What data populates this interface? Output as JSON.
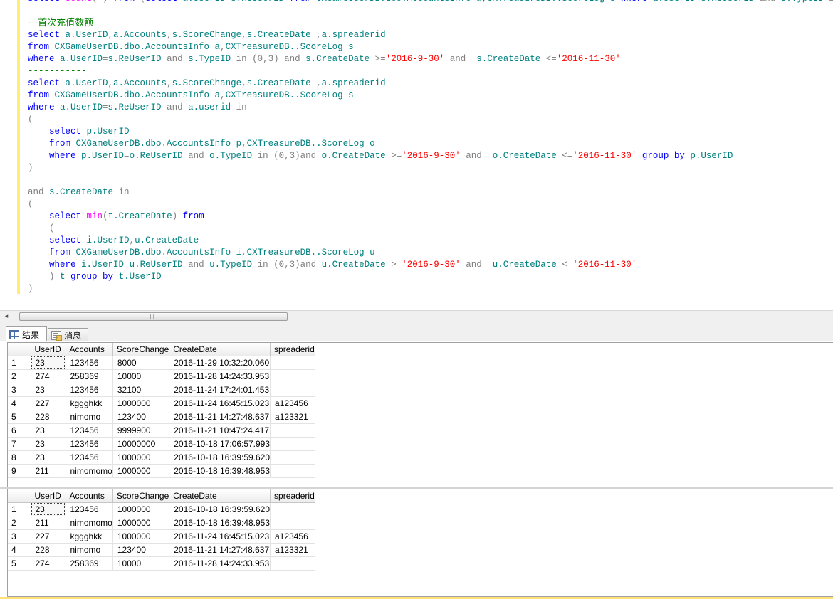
{
  "editor": {
    "lines": [
      [
        {
          "t": "select ",
          "c": "kw"
        },
        {
          "t": "count",
          "c": "fn"
        },
        {
          "t": "(*) ",
          "c": "gy"
        },
        {
          "t": "from ",
          "c": "kw"
        },
        {
          "t": "(",
          "c": "gy"
        },
        {
          "t": "select ",
          "c": "kw"
        },
        {
          "t": "a.UserID s.ReUserID ",
          "c": "tl"
        },
        {
          "t": "from ",
          "c": "kw"
        },
        {
          "t": "CXGameUserDB.dbo.AccountsInfo a,CXTreasureDB..ScoreLog s ",
          "c": "tl"
        },
        {
          "t": "where ",
          "c": "kw"
        },
        {
          "t": "a.UserID=s.ReUserID ",
          "c": "tl"
        },
        {
          "t": "and ",
          "c": "gy"
        },
        {
          "t": "s.TypeID ",
          "c": "tl"
        },
        {
          "t": "in",
          "c": "gy"
        }
      ],
      [],
      [
        {
          "t": "---首次充值数额",
          "c": "cm cm-cjk"
        }
      ],
      [
        {
          "t": "select ",
          "c": "kw"
        },
        {
          "t": "a.UserID",
          "c": "tl"
        },
        {
          "t": ",",
          "c": "gy"
        },
        {
          "t": "a.Accounts",
          "c": "tl"
        },
        {
          "t": ",",
          "c": "gy"
        },
        {
          "t": "s.ScoreChange",
          "c": "tl"
        },
        {
          "t": ",",
          "c": "gy"
        },
        {
          "t": "s.CreateDate ",
          "c": "tl"
        },
        {
          "t": ",",
          "c": "gy"
        },
        {
          "t": "a.spreaderid",
          "c": "tl"
        }
      ],
      [
        {
          "t": "from ",
          "c": "kw"
        },
        {
          "t": "CXGameUserDB.dbo.AccountsInfo a",
          "c": "tl"
        },
        {
          "t": ",",
          "c": "gy"
        },
        {
          "t": "CXTreasureDB..ScoreLog s",
          "c": "tl"
        }
      ],
      [
        {
          "t": "where ",
          "c": "kw"
        },
        {
          "t": "a.UserID",
          "c": "tl"
        },
        {
          "t": "=",
          "c": "gy"
        },
        {
          "t": "s.ReUserID ",
          "c": "tl"
        },
        {
          "t": "and ",
          "c": "gy"
        },
        {
          "t": "s.TypeID ",
          "c": "tl"
        },
        {
          "t": "in ",
          "c": "gy"
        },
        {
          "t": "(0,3) ",
          "c": "gy"
        },
        {
          "t": "and ",
          "c": "gy"
        },
        {
          "t": "s.CreateDate ",
          "c": "tl"
        },
        {
          "t": ">=",
          "c": "gy"
        },
        {
          "t": "'2016-9-30' ",
          "c": "str"
        },
        {
          "t": "and  ",
          "c": "gy"
        },
        {
          "t": "s.CreateDate ",
          "c": "tl"
        },
        {
          "t": "<=",
          "c": "gy"
        },
        {
          "t": "'2016-11-30'",
          "c": "str"
        }
      ],
      [
        {
          "t": "-----------",
          "c": "cm"
        }
      ],
      [
        {
          "t": "select ",
          "c": "kw"
        },
        {
          "t": "a.UserID",
          "c": "tl"
        },
        {
          "t": ",",
          "c": "gy"
        },
        {
          "t": "a.Accounts",
          "c": "tl"
        },
        {
          "t": ",",
          "c": "gy"
        },
        {
          "t": "s.ScoreChange",
          "c": "tl"
        },
        {
          "t": ",",
          "c": "gy"
        },
        {
          "t": "s.CreateDate ",
          "c": "tl"
        },
        {
          "t": ",",
          "c": "gy"
        },
        {
          "t": "a.spreaderid",
          "c": "tl"
        }
      ],
      [
        {
          "t": "from ",
          "c": "kw"
        },
        {
          "t": "CXGameUserDB.dbo.AccountsInfo a",
          "c": "tl"
        },
        {
          "t": ",",
          "c": "gy"
        },
        {
          "t": "CXTreasureDB..ScoreLog s",
          "c": "tl"
        }
      ],
      [
        {
          "t": "where ",
          "c": "kw"
        },
        {
          "t": "a.UserID",
          "c": "tl"
        },
        {
          "t": "=",
          "c": "gy"
        },
        {
          "t": "s.ReUserID ",
          "c": "tl"
        },
        {
          "t": "and ",
          "c": "gy"
        },
        {
          "t": "a.userid ",
          "c": "tl"
        },
        {
          "t": "in",
          "c": "gy"
        }
      ],
      [
        {
          "t": "(",
          "c": "gy"
        }
      ],
      [
        {
          "t": "    "
        },
        {
          "t": "select ",
          "c": "kw"
        },
        {
          "t": "p.UserID",
          "c": "tl"
        }
      ],
      [
        {
          "t": "    "
        },
        {
          "t": "from ",
          "c": "kw"
        },
        {
          "t": "CXGameUserDB.dbo.AccountsInfo p",
          "c": "tl"
        },
        {
          "t": ",",
          "c": "gy"
        },
        {
          "t": "CXTreasureDB..ScoreLog o",
          "c": "tl"
        }
      ],
      [
        {
          "t": "    "
        },
        {
          "t": "where ",
          "c": "kw"
        },
        {
          "t": "p.UserID",
          "c": "tl"
        },
        {
          "t": "=",
          "c": "gy"
        },
        {
          "t": "o.ReUserID ",
          "c": "tl"
        },
        {
          "t": "and ",
          "c": "gy"
        },
        {
          "t": "o.TypeID ",
          "c": "tl"
        },
        {
          "t": "in ",
          "c": "gy"
        },
        {
          "t": "(0,3)",
          "c": "gy"
        },
        {
          "t": "and ",
          "c": "gy"
        },
        {
          "t": "o.CreateDate ",
          "c": "tl"
        },
        {
          "t": ">=",
          "c": "gy"
        },
        {
          "t": "'2016-9-30' ",
          "c": "str"
        },
        {
          "t": "and  ",
          "c": "gy"
        },
        {
          "t": "o.CreateDate ",
          "c": "tl"
        },
        {
          "t": "<=",
          "c": "gy"
        },
        {
          "t": "'2016-11-30' ",
          "c": "str"
        },
        {
          "t": "group by ",
          "c": "kw"
        },
        {
          "t": "p.UserID",
          "c": "tl"
        }
      ],
      [
        {
          "t": ")",
          "c": "gy"
        }
      ],
      [],
      [
        {
          "t": "and ",
          "c": "gy"
        },
        {
          "t": "s.CreateDate ",
          "c": "tl"
        },
        {
          "t": "in",
          "c": "gy"
        }
      ],
      [
        {
          "t": "(",
          "c": "gy"
        }
      ],
      [
        {
          "t": "    "
        },
        {
          "t": "select ",
          "c": "kw"
        },
        {
          "t": "min",
          "c": "fn"
        },
        {
          "t": "(",
          "c": "gy"
        },
        {
          "t": "t.CreateDate",
          "c": "tl"
        },
        {
          "t": ") ",
          "c": "gy"
        },
        {
          "t": "from",
          "c": "kw"
        }
      ],
      [
        {
          "t": "    "
        },
        {
          "t": "(",
          "c": "gy"
        }
      ],
      [
        {
          "t": "    "
        },
        {
          "t": "select ",
          "c": "kw"
        },
        {
          "t": "i.UserID",
          "c": "tl"
        },
        {
          "t": ",",
          "c": "gy"
        },
        {
          "t": "u.CreateDate",
          "c": "tl"
        }
      ],
      [
        {
          "t": "    "
        },
        {
          "t": "from ",
          "c": "kw"
        },
        {
          "t": "CXGameUserDB.dbo.AccountsInfo i",
          "c": "tl"
        },
        {
          "t": ",",
          "c": "gy"
        },
        {
          "t": "CXTreasureDB..ScoreLog u",
          "c": "tl"
        }
      ],
      [
        {
          "t": "    "
        },
        {
          "t": "where ",
          "c": "kw"
        },
        {
          "t": "i.UserID",
          "c": "tl"
        },
        {
          "t": "=",
          "c": "gy"
        },
        {
          "t": "u.ReUserID ",
          "c": "tl"
        },
        {
          "t": "and ",
          "c": "gy"
        },
        {
          "t": "u.TypeID ",
          "c": "tl"
        },
        {
          "t": "in ",
          "c": "gy"
        },
        {
          "t": "(0,3)",
          "c": "gy"
        },
        {
          "t": "and ",
          "c": "gy"
        },
        {
          "t": "u.CreateDate ",
          "c": "tl"
        },
        {
          "t": ">=",
          "c": "gy"
        },
        {
          "t": "'2016-9-30' ",
          "c": "str"
        },
        {
          "t": "and  ",
          "c": "gy"
        },
        {
          "t": "u.CreateDate ",
          "c": "tl"
        },
        {
          "t": "<=",
          "c": "gy"
        },
        {
          "t": "'2016-11-30'",
          "c": "str"
        }
      ],
      [
        {
          "t": "    "
        },
        {
          "t": ") ",
          "c": "gy"
        },
        {
          "t": "t ",
          "c": "tl"
        },
        {
          "t": "group by ",
          "c": "kw"
        },
        {
          "t": "t.UserID",
          "c": "tl"
        }
      ],
      [
        {
          "t": ")",
          "c": "gy"
        }
      ]
    ]
  },
  "scrollbar": {
    "left_arrow": "◂",
    "grip": "III"
  },
  "tabs": {
    "results_label": "结果",
    "messages_label": "消息"
  },
  "results": {
    "columns": [
      "UserID",
      "Accounts",
      "ScoreChange",
      "CreateDate",
      "spreaderid"
    ],
    "grid1": [
      [
        "1",
        "23",
        "123456",
        "8000",
        "2016-11-29 10:32:20.060",
        ""
      ],
      [
        "2",
        "274",
        "258369",
        "10000",
        "2016-11-28 14:24:33.953",
        ""
      ],
      [
        "3",
        "23",
        "123456",
        "32100",
        "2016-11-24 17:24:01.453",
        ""
      ],
      [
        "4",
        "227",
        "kggghkk",
        "1000000",
        "2016-11-24 16:45:15.023",
        "a123456"
      ],
      [
        "5",
        "228",
        "nimomo",
        "123400",
        "2016-11-21 14:27:48.637",
        "a123321"
      ],
      [
        "6",
        "23",
        "123456",
        "9999900",
        "2016-11-21 10:47:24.417",
        ""
      ],
      [
        "7",
        "23",
        "123456",
        "10000000",
        "2016-10-18 17:06:57.993",
        ""
      ],
      [
        "8",
        "23",
        "123456",
        "1000000",
        "2016-10-18 16:39:59.620",
        ""
      ],
      [
        "9",
        "211",
        "nimomomo",
        "1000000",
        "2016-10-18 16:39:48.953",
        ""
      ]
    ],
    "grid2": [
      [
        "1",
        "23",
        "123456",
        "1000000",
        "2016-10-18 16:39:59.620",
        ""
      ],
      [
        "2",
        "211",
        "nimomomo",
        "1000000",
        "2016-10-18 16:39:48.953",
        ""
      ],
      [
        "3",
        "227",
        "kggghkk",
        "1000000",
        "2016-11-24 16:45:15.023",
        "a123456"
      ],
      [
        "4",
        "228",
        "nimomo",
        "123400",
        "2016-11-21 14:27:48.637",
        "a123321"
      ],
      [
        "5",
        "274",
        "258369",
        "10000",
        "2016-11-28 14:24:33.953",
        ""
      ]
    ]
  },
  "colors": {
    "keyword": "#0000ff",
    "function": "#ff00ff",
    "string": "#ff0000",
    "comment": "#008000",
    "operator": "#808080",
    "identifier": "#008080",
    "change_bar": "#ffef6e"
  }
}
